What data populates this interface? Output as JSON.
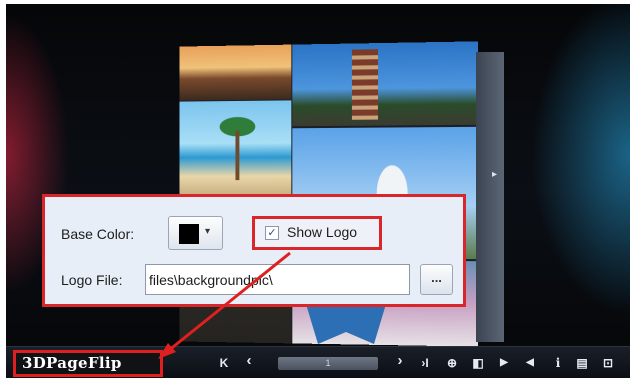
{
  "panel": {
    "base_color_label": "Base Color:",
    "base_color_value": "#000000",
    "show_logo_label": "Show Logo",
    "show_logo_checked": true,
    "show_logo_check_glyph": "✓",
    "logo_file_label": "Logo File:",
    "logo_file_value": "files\\backgroundpic\\",
    "browse_label": "...",
    "dropdown_glyph": "▾"
  },
  "toolbar": {
    "brand": "3DPageFlip",
    "page_number": "1",
    "first_glyph": "K",
    "prev_glyph": "‹",
    "next_glyph": "›",
    "last_glyph": "›I",
    "zoom_glyph": "⊕",
    "thumbnails_glyph": "◧",
    "play_glyph": "▶",
    "sound_glyph": "◀",
    "info_glyph": "i",
    "print_glyph": "▤",
    "fullscreen_glyph": "⊡"
  },
  "book": {
    "page_arrow_glyph": "▸"
  },
  "colors": {
    "highlight": "#d9262a",
    "panel_bg": "#e8eef7",
    "toolbar_bg": "#0c0f14"
  }
}
